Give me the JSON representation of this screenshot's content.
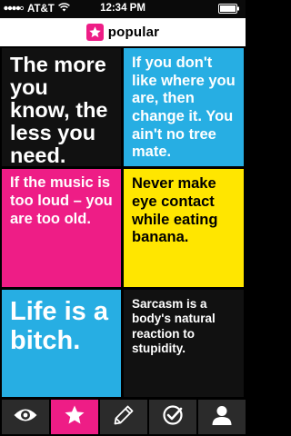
{
  "status_bar": {
    "carrier": "AT&T",
    "time": "12:34 PM"
  },
  "header": {
    "title": "popular",
    "icon": "star-icon"
  },
  "cards": [
    {
      "text": "The more you know, the less you need.",
      "color": "#111111",
      "text_color": "#ffffff"
    },
    {
      "text": "If you don't like where you are, then change it. You ain't no tree mate.",
      "color": "#27aee3",
      "text_color": "#ffffff"
    },
    {
      "text": "If the music is too loud – you are too old.",
      "color": "#ee1d86",
      "text_color": "#ffffff"
    },
    {
      "text": "Never make eye contact while eating banana.",
      "color": "#ffe600",
      "text_color": "#000000"
    },
    {
      "text": "Life is a bitch.",
      "color": "#27aee3",
      "text_color": "#ffffff"
    },
    {
      "text": "Sarcasm is a body's natural reaction to stupidity.",
      "color": "#111111",
      "text_color": "#ffffff"
    }
  ],
  "tab_bar": {
    "tabs": [
      {
        "icon": "eye-icon",
        "active": false
      },
      {
        "icon": "star-icon",
        "active": true
      },
      {
        "icon": "pencil-icon",
        "active": false
      },
      {
        "icon": "check-icon",
        "active": false
      },
      {
        "icon": "user-icon",
        "active": false
      }
    ],
    "accent": "#ee1d86"
  }
}
